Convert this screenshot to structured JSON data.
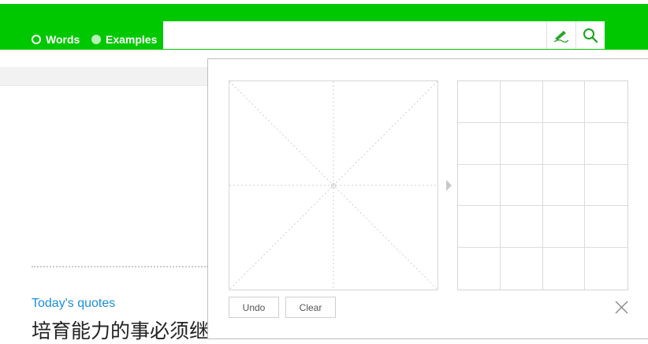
{
  "header": {
    "modes": [
      {
        "label": "Words",
        "selected": false
      },
      {
        "label": "Examples",
        "selected": true
      }
    ],
    "search": {
      "value": "",
      "placeholder": ""
    },
    "handwrite_icon": "handwriting-pen-icon",
    "search_icon": "search-icon",
    "accent_color": "#00c800"
  },
  "main": {
    "quotes_title": "Today's quotes",
    "quote_text": "培育能力的事必须继"
  },
  "handwriting_panel": {
    "undo_label": "Undo",
    "clear_label": "Clear",
    "close_icon": "close-icon",
    "candidate_rows": 5,
    "candidate_cols": 4
  }
}
